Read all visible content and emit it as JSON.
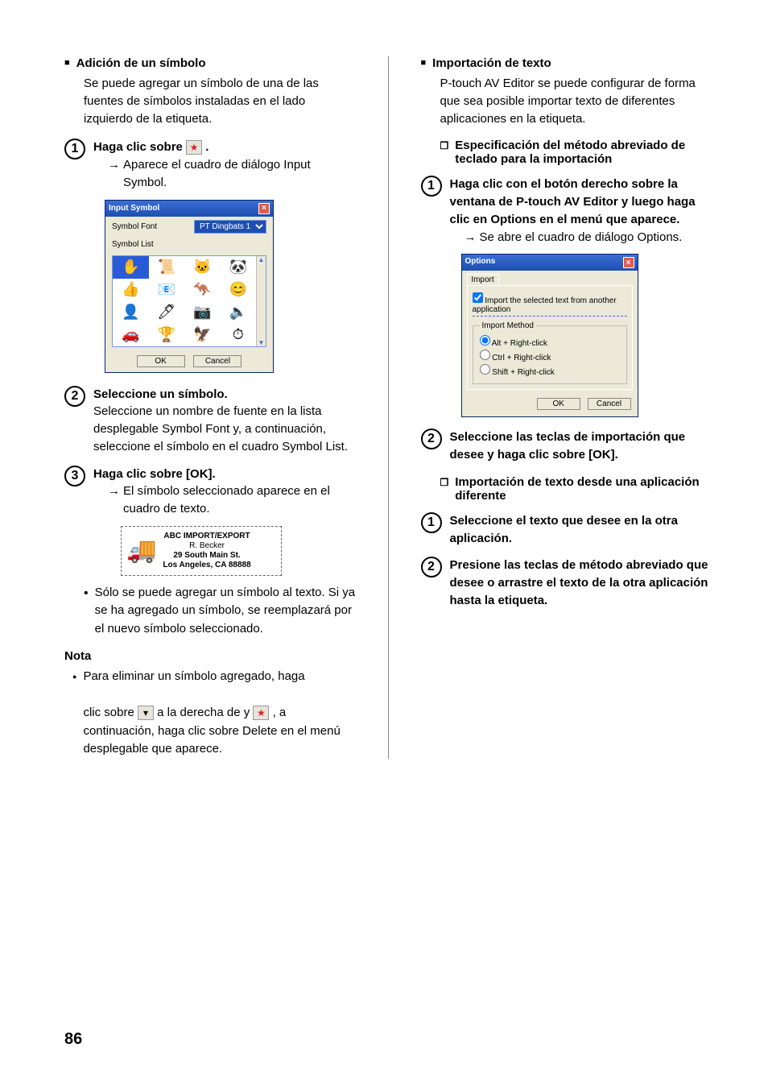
{
  "leftCol": {
    "h1": "Adición de un símbolo",
    "p1": "Se puede agregar un símbolo de una de las fuentes de símbolos instaladas en el lado izquierdo de la etiqueta.",
    "step1": {
      "num": "1",
      "boldPrefix": "Haga clic sobre ",
      "boldSuffix": " .",
      "result": "Aparece el cuadro de diálogo Input Symbol."
    },
    "dlgInput": {
      "title": "Input Symbol",
      "fontLabel": "Symbol Font",
      "fontValue": "PT Dingbats 1",
      "listLabel": "Symbol List",
      "symbols": [
        "✋",
        "📜",
        "🐱",
        "🐼",
        "👍",
        "📧",
        "🦘",
        "😊",
        "👤",
        "🖊",
        "📷",
        "🔈",
        "🚗",
        "🏆",
        "🦅",
        "⏱"
      ],
      "ok": "OK",
      "cancel": "Cancel"
    },
    "step2": {
      "num": "2",
      "bold": "Seleccione un símbolo.",
      "text": "Seleccione un nombre de fuente en la lista desplegable Symbol Font y, a continuación, seleccione el símbolo en el cuadro Symbol List."
    },
    "step3": {
      "num": "3",
      "bold": "Haga clic sobre [OK].",
      "result": "El símbolo seleccionado aparece en el cuadro de texto."
    },
    "labelPrev": {
      "l1": "ABC IMPORT/EXPORT",
      "l2": "R. Becker",
      "l3": "29 South Main St.",
      "l4": "Los Angeles, CA 88888"
    },
    "bullet": "Sólo se puede agregar un símbolo al texto. Si ya se ha agregado un símbolo, se reemplazará por el nuevo símbolo seleccionado.",
    "noteH": "Nota",
    "noteTextA": "Para eliminar un símbolo agregado, haga",
    "noteTextB_pre": "clic sobre ",
    "noteTextB_mid": " a la derecha de y ",
    "noteTextB_post": " , a continuación, haga clic sobre Delete en el menú desplegable que aparece."
  },
  "rightCol": {
    "h1": "Importación de texto",
    "p1": "P-touch AV Editor se puede configurar de forma que sea posible importar texto de diferentes aplicaciones en la etiqueta.",
    "sub1": "Especificación del método abreviado de teclado para la importación",
    "step1": {
      "num": "1",
      "bold": "Haga clic con el botón derecho sobre la ventana de P-touch AV Editor y luego haga clic en Options en el menú que aparece.",
      "result": "Se abre el cuadro de diálogo Options."
    },
    "dlgOptions": {
      "title": "Options",
      "tab": "Import",
      "chk": "Import the selected text from another application",
      "legend": "Import Method",
      "opt1": "Alt + Right-click",
      "opt2": "Ctrl + Right-click",
      "opt3": "Shift + Right-click",
      "ok": "OK",
      "cancel": "Cancel"
    },
    "step2": {
      "num": "2",
      "bold": "Seleccione las teclas de importación que desee y haga clic sobre [OK]."
    },
    "sub2": "Importación de texto desde una aplicación diferente",
    "step3": {
      "num": "1",
      "bold": "Seleccione el texto que desee en la otra aplicación."
    },
    "step4": {
      "num": "2",
      "bold": "Presione las teclas de método abreviado que desee o arrastre el texto de la otra aplicación hasta la etiqueta."
    }
  },
  "pageNum": "86"
}
